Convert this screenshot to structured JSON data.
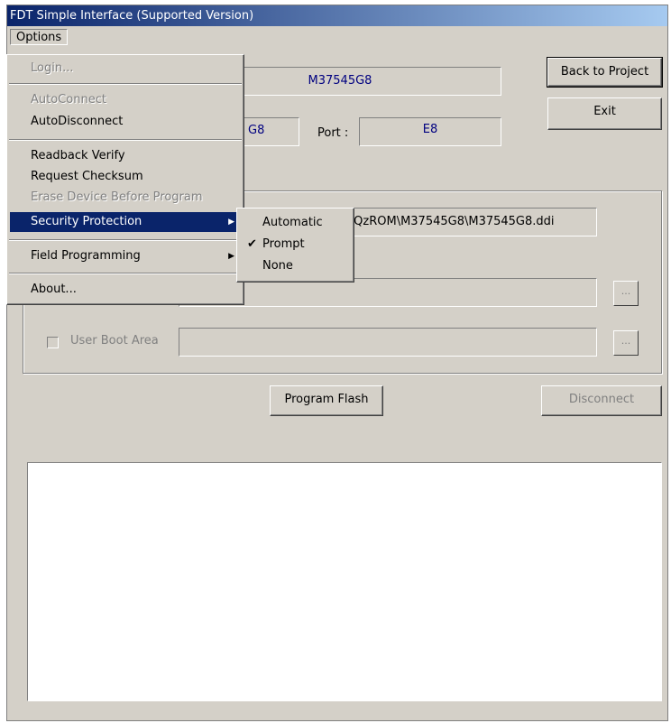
{
  "window": {
    "title": "FDT Simple Interface   (Supported Version)"
  },
  "menubar": {
    "options_label": "Options"
  },
  "device": {
    "value": "M37545G8",
    "port_label": "Port :",
    "port_value": "E8",
    "device_partial": "G8"
  },
  "file": {
    "path_partial": "es\\QzROM\\M37545G8\\M37545G8.ddi"
  },
  "user_boot": {
    "label": "User Boot Area",
    "browse": "..."
  },
  "browse_label": "...",
  "buttons": {
    "back_to_project": "Back to Project",
    "exit": "Exit",
    "program_flash": "Program Flash",
    "disconnect": "Disconnect"
  },
  "options_menu": {
    "items": [
      {
        "label": "Login...",
        "disabled": true
      },
      {
        "label": "AutoConnect",
        "disabled": true
      },
      {
        "label": "AutoDisconnect",
        "disabled": false
      },
      {
        "label": "Readback Verify",
        "disabled": false
      },
      {
        "label": "Request Checksum",
        "disabled": false
      },
      {
        "label": "Erase Device Before Program",
        "disabled": true
      },
      {
        "label": "Security Protection",
        "disabled": false,
        "submenu": true,
        "selected": true
      },
      {
        "label": "Field Programming",
        "disabled": false,
        "submenu": true
      },
      {
        "label": "About...",
        "disabled": false
      }
    ]
  },
  "security_submenu": {
    "items": [
      {
        "label": "Automatic",
        "checked": false
      },
      {
        "label": "Prompt",
        "checked": true
      },
      {
        "label": "None",
        "checked": false
      }
    ]
  },
  "colors": {
    "titlebar": "#0a246a",
    "window_bg": "#d4d0c8",
    "highlight": "#0a246a",
    "value_text": "#000080"
  }
}
